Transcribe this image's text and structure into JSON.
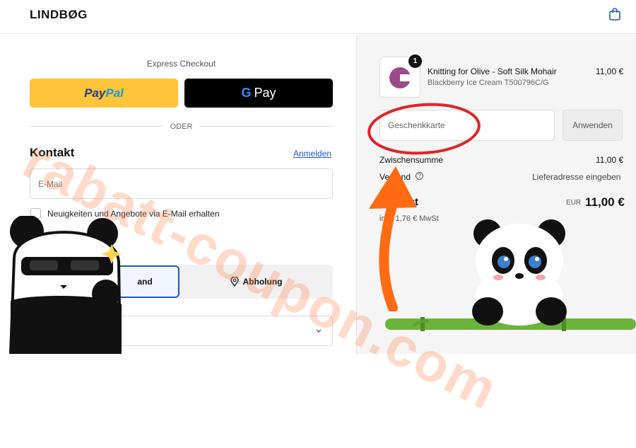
{
  "header": {
    "logo": "LINDBØG",
    "cart_icon": "shopping-bag-icon"
  },
  "express": {
    "label": "Express Checkout",
    "paypal_part1": "Pay",
    "paypal_part2": "Pal",
    "gpay_g": "G",
    "gpay_label": "Pay"
  },
  "divider": {
    "label": "ODER"
  },
  "contact": {
    "title": "Kontakt",
    "login_link": "Anmelden",
    "email_placeholder": "E-Mail",
    "newsletter_label": "Neuigkeiten und Angebote via E-Mail erhalten"
  },
  "delivery": {
    "ship_label": "and",
    "pickup_label": "Abholung",
    "pickup_icon": "location-pin-icon",
    "select_icon": "chevron-down-icon"
  },
  "order": {
    "quantity": "1",
    "product_title": "Knitting for Olive - Soft Silk Mohair",
    "product_variant": "Blackberry Ice Cream T500796C/G",
    "product_price": "11,00 €",
    "thumb_color": "#9b4a8c"
  },
  "gift_card": {
    "placeholder": "Geschenkkarte",
    "apply_label": "Anwenden"
  },
  "summary": {
    "subtotal_label": "Zwischensumme",
    "subtotal_value": "11,00 €",
    "shipping_label": "Versand",
    "shipping_value": "Lieferadresse eingeben",
    "total_label": "Gesamt",
    "total_currency": "EUR",
    "total_value": "11,00 €",
    "tax_note": "inkl. 1,76 € MwSt"
  },
  "watermark": {
    "text": "rabatt-coupon.com"
  },
  "colors": {
    "accent": "#1f57c3",
    "paypal": "#ffc43a",
    "arrow": "#ff6a13",
    "circle": "#e0242a"
  }
}
